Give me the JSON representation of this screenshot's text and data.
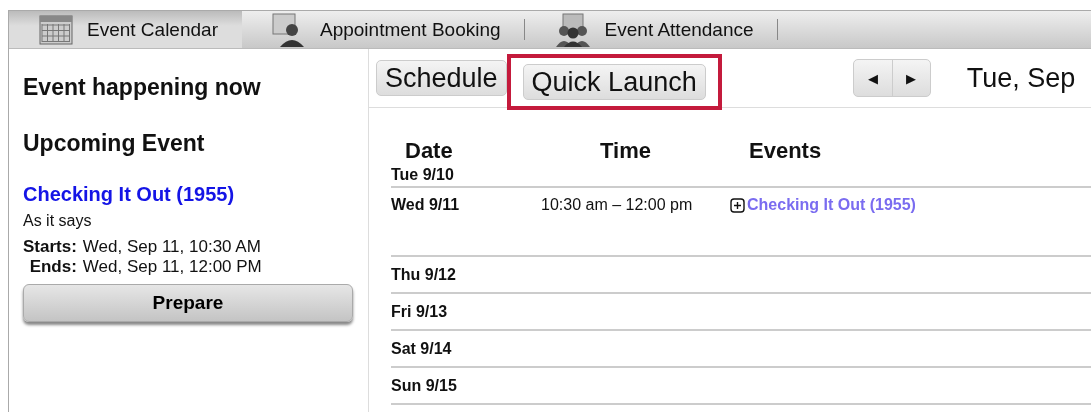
{
  "tabs": [
    {
      "label": "Event Calendar",
      "selected": true
    },
    {
      "label": "Appointment Booking",
      "selected": false
    },
    {
      "label": "Event Attendance",
      "selected": false
    }
  ],
  "sidebar": {
    "now_heading": "Event happening now",
    "upcoming_heading": "Upcoming Event",
    "event_title": "Checking It Out (1955)",
    "event_description": "As it says",
    "starts_label": "Starts:",
    "starts_value": "Wed, Sep 11, 10:30 AM",
    "ends_label": "Ends:",
    "ends_value": "Wed, Sep 11, 12:00 PM",
    "button": "Prepare"
  },
  "toolbar": {
    "buttons": [
      {
        "label": "Schedule",
        "highlighted": false
      },
      {
        "label": "Quick Launch",
        "highlighted": true
      }
    ],
    "prev": "◀",
    "next": "▶",
    "date": "Tue, Sep"
  },
  "table": {
    "columns": [
      "Date",
      "Time",
      "Events"
    ],
    "rows": [
      {
        "date": "Tue 9/10"
      },
      {
        "date": "Wed 9/11",
        "time": "10:30 am – 12:00 pm",
        "event": "Checking It Out (1955)"
      },
      {
        "date": "Thu 9/12"
      },
      {
        "date": "Fri 9/13"
      },
      {
        "date": "Sat 9/14"
      },
      {
        "date": "Sun 9/15"
      }
    ]
  }
}
